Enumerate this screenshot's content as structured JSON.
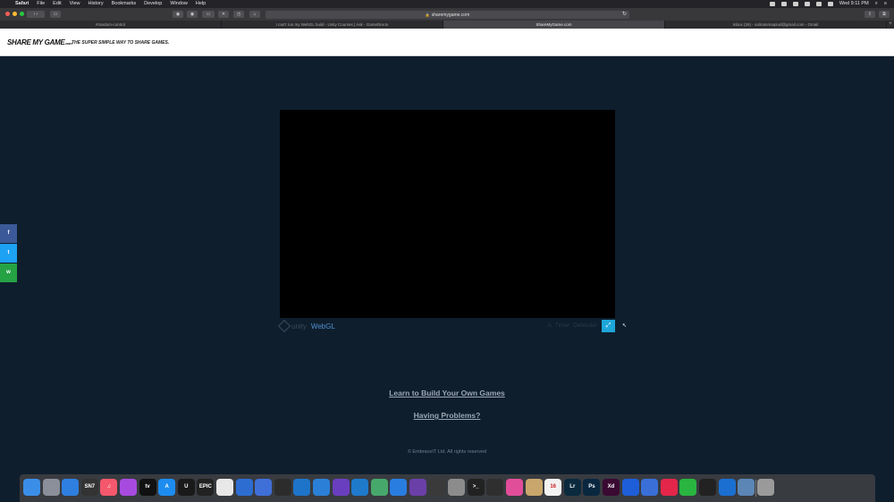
{
  "menubar": {
    "app": "Safari",
    "items": [
      "File",
      "Edit",
      "View",
      "History",
      "Bookmarks",
      "Develop",
      "Window",
      "Help"
    ],
    "clock": "Wed 9:11 PM"
  },
  "browser": {
    "url": "sharemygame.com",
    "tabs": [
      {
        "label": "#random-control",
        "active": false
      },
      {
        "label": "I can't run my WebGL build - Unity Courses | Ask - GameDev.tv",
        "active": false
      },
      {
        "label": "ShareMyGame.com",
        "active": true
      },
      {
        "label": "Inbox (26) - salmanmaqsud@gmail.com - Gmail",
        "active": false
      }
    ]
  },
  "site": {
    "logo": "SHARE MY GAME",
    "logo_suffix": ".com",
    "tagline": "THE SUPER SIMPLE WAY TO SHARE GAMES."
  },
  "social": {
    "facebook": "f",
    "twitter": "t",
    "whatsapp": "w",
    "colors": {
      "facebook": "#3b5998",
      "twitter": "#1da1f2",
      "whatsapp": "#25a244"
    }
  },
  "player": {
    "unity_label": "unity",
    "webgl_label": "WebGL",
    "meta_1": "A",
    "meta_2": "Timer",
    "meta_3": "Defender",
    "fullscreen_icon": "⤢"
  },
  "links": {
    "learn": "Learn to Build Your Own Games",
    "problems": "Having Problems?"
  },
  "footer": {
    "copyright": "© EmbraceIT Ltd. All rights reserved"
  },
  "dock": {
    "apps": [
      {
        "name": "finder",
        "label": "",
        "color": "#3b8ee8"
      },
      {
        "name": "launchpad",
        "label": "",
        "color": "#8a8f99"
      },
      {
        "name": "safari",
        "label": "",
        "color": "#2f7fe0"
      },
      {
        "name": "sn7",
        "label": "SN7",
        "color": "#333333"
      },
      {
        "name": "music",
        "label": "♫",
        "color": "#f5586c"
      },
      {
        "name": "podcasts",
        "label": "",
        "color": "#a74be0"
      },
      {
        "name": "tv",
        "label": "tv",
        "color": "#111111"
      },
      {
        "name": "appstore",
        "label": "A",
        "color": "#1d8cf0"
      },
      {
        "name": "unreal",
        "label": "U",
        "color": "#1a1a1a"
      },
      {
        "name": "epic",
        "label": "EPIC",
        "color": "#222222"
      },
      {
        "name": "unity-hub",
        "label": "",
        "color": "#e8e8e8"
      },
      {
        "name": "sourcetree",
        "label": "",
        "color": "#2d6cd1"
      },
      {
        "name": "app-13",
        "label": "",
        "color": "#3f6fd8"
      },
      {
        "name": "obs",
        "label": "",
        "color": "#2c2c2c"
      },
      {
        "name": "edge",
        "label": "",
        "color": "#1e74c8"
      },
      {
        "name": "xcode",
        "label": "",
        "color": "#2b7fd6"
      },
      {
        "name": "visual-studio",
        "label": "",
        "color": "#6a3fbf"
      },
      {
        "name": "vscode",
        "label": "",
        "color": "#1f7acc"
      },
      {
        "name": "app-19",
        "label": "",
        "color": "#47a86c"
      },
      {
        "name": "maps",
        "label": "",
        "color": "#2a7de0"
      },
      {
        "name": "github",
        "label": "",
        "color": "#6b3fa8"
      },
      {
        "name": "app-22",
        "label": "",
        "color": "#3a3a3a"
      },
      {
        "name": "system-preferences",
        "label": "",
        "color": "#8c8c8c"
      },
      {
        "name": "terminal",
        "label": ">_",
        "color": "#222222"
      },
      {
        "name": "activity-monitor",
        "label": "",
        "color": "#2f2f2f"
      },
      {
        "name": "app-26",
        "label": "",
        "color": "#e24d9a"
      },
      {
        "name": "app-27",
        "label": "",
        "color": "#c9a66b"
      },
      {
        "name": "calendar",
        "label": "16",
        "color": "#f2f2f2"
      },
      {
        "name": "lightroom",
        "label": "Lr",
        "color": "#0b2a3d"
      },
      {
        "name": "photoshop",
        "label": "Ps",
        "color": "#0a2740"
      },
      {
        "name": "xd",
        "label": "Xd",
        "color": "#3a0a33"
      },
      {
        "name": "framer",
        "label": "",
        "color": "#1e5ed8"
      },
      {
        "name": "affinity",
        "label": "",
        "color": "#3a6fd8"
      },
      {
        "name": "app-34",
        "label": "",
        "color": "#e3264a"
      },
      {
        "name": "whatsapp",
        "label": "",
        "color": "#2ab540"
      },
      {
        "name": "unity",
        "label": "",
        "color": "#222222"
      },
      {
        "name": "1password",
        "label": "",
        "color": "#1a6fd0"
      },
      {
        "name": "app-38",
        "label": "",
        "color": "#5b86b5"
      },
      {
        "name": "trash",
        "label": "",
        "color": "#9a9a9a"
      }
    ]
  }
}
